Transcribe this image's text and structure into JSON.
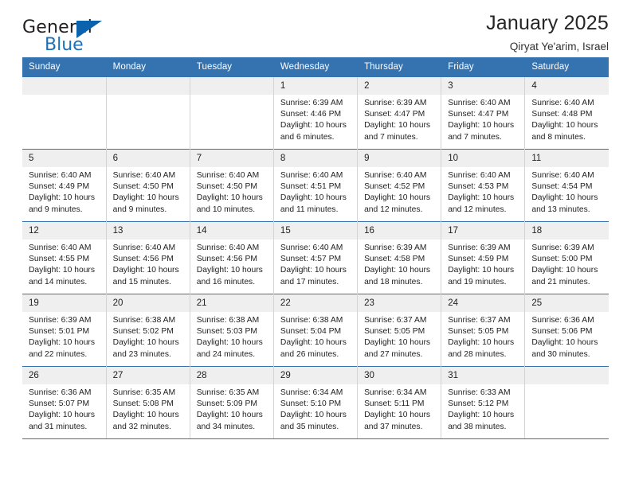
{
  "brand": {
    "name_part1": "General",
    "name_part2": "Blue",
    "triangle_icon": "blue-triangle-logo"
  },
  "header": {
    "title": "January 2025",
    "subtitle": "Qiryat Ye'arim, Israel"
  },
  "colors": {
    "header_blue": "#3572b0",
    "brand_blue": "#1d71b8",
    "daynum_band": "#efefef",
    "grid_line": "#d4d4d4"
  },
  "weekday_headers": [
    "Sunday",
    "Monday",
    "Tuesday",
    "Wednesday",
    "Thursday",
    "Friday",
    "Saturday"
  ],
  "labels": {
    "sunrise_prefix": "Sunrise:",
    "sunset_prefix": "Sunset:",
    "daylight_prefix": "Daylight:"
  },
  "weeks": [
    [
      {
        "empty": true
      },
      {
        "empty": true
      },
      {
        "empty": true
      },
      {
        "day": "1",
        "sunrise": "Sunrise: 6:39 AM",
        "sunset": "Sunset: 4:46 PM",
        "daylight1": "Daylight: 10 hours",
        "daylight2": "and 6 minutes."
      },
      {
        "day": "2",
        "sunrise": "Sunrise: 6:39 AM",
        "sunset": "Sunset: 4:47 PM",
        "daylight1": "Daylight: 10 hours",
        "daylight2": "and 7 minutes."
      },
      {
        "day": "3",
        "sunrise": "Sunrise: 6:40 AM",
        "sunset": "Sunset: 4:47 PM",
        "daylight1": "Daylight: 10 hours",
        "daylight2": "and 7 minutes."
      },
      {
        "day": "4",
        "sunrise": "Sunrise: 6:40 AM",
        "sunset": "Sunset: 4:48 PM",
        "daylight1": "Daylight: 10 hours",
        "daylight2": "and 8 minutes."
      }
    ],
    [
      {
        "day": "5",
        "sunrise": "Sunrise: 6:40 AM",
        "sunset": "Sunset: 4:49 PM",
        "daylight1": "Daylight: 10 hours",
        "daylight2": "and 9 minutes."
      },
      {
        "day": "6",
        "sunrise": "Sunrise: 6:40 AM",
        "sunset": "Sunset: 4:50 PM",
        "daylight1": "Daylight: 10 hours",
        "daylight2": "and 9 minutes."
      },
      {
        "day": "7",
        "sunrise": "Sunrise: 6:40 AM",
        "sunset": "Sunset: 4:50 PM",
        "daylight1": "Daylight: 10 hours",
        "daylight2": "and 10 minutes."
      },
      {
        "day": "8",
        "sunrise": "Sunrise: 6:40 AM",
        "sunset": "Sunset: 4:51 PM",
        "daylight1": "Daylight: 10 hours",
        "daylight2": "and 11 minutes."
      },
      {
        "day": "9",
        "sunrise": "Sunrise: 6:40 AM",
        "sunset": "Sunset: 4:52 PM",
        "daylight1": "Daylight: 10 hours",
        "daylight2": "and 12 minutes."
      },
      {
        "day": "10",
        "sunrise": "Sunrise: 6:40 AM",
        "sunset": "Sunset: 4:53 PM",
        "daylight1": "Daylight: 10 hours",
        "daylight2": "and 12 minutes."
      },
      {
        "day": "11",
        "sunrise": "Sunrise: 6:40 AM",
        "sunset": "Sunset: 4:54 PM",
        "daylight1": "Daylight: 10 hours",
        "daylight2": "and 13 minutes."
      }
    ],
    [
      {
        "day": "12",
        "sunrise": "Sunrise: 6:40 AM",
        "sunset": "Sunset: 4:55 PM",
        "daylight1": "Daylight: 10 hours",
        "daylight2": "and 14 minutes."
      },
      {
        "day": "13",
        "sunrise": "Sunrise: 6:40 AM",
        "sunset": "Sunset: 4:56 PM",
        "daylight1": "Daylight: 10 hours",
        "daylight2": "and 15 minutes."
      },
      {
        "day": "14",
        "sunrise": "Sunrise: 6:40 AM",
        "sunset": "Sunset: 4:56 PM",
        "daylight1": "Daylight: 10 hours",
        "daylight2": "and 16 minutes."
      },
      {
        "day": "15",
        "sunrise": "Sunrise: 6:40 AM",
        "sunset": "Sunset: 4:57 PM",
        "daylight1": "Daylight: 10 hours",
        "daylight2": "and 17 minutes."
      },
      {
        "day": "16",
        "sunrise": "Sunrise: 6:39 AM",
        "sunset": "Sunset: 4:58 PM",
        "daylight1": "Daylight: 10 hours",
        "daylight2": "and 18 minutes."
      },
      {
        "day": "17",
        "sunrise": "Sunrise: 6:39 AM",
        "sunset": "Sunset: 4:59 PM",
        "daylight1": "Daylight: 10 hours",
        "daylight2": "and 19 minutes."
      },
      {
        "day": "18",
        "sunrise": "Sunrise: 6:39 AM",
        "sunset": "Sunset: 5:00 PM",
        "daylight1": "Daylight: 10 hours",
        "daylight2": "and 21 minutes."
      }
    ],
    [
      {
        "day": "19",
        "sunrise": "Sunrise: 6:39 AM",
        "sunset": "Sunset: 5:01 PM",
        "daylight1": "Daylight: 10 hours",
        "daylight2": "and 22 minutes."
      },
      {
        "day": "20",
        "sunrise": "Sunrise: 6:38 AM",
        "sunset": "Sunset: 5:02 PM",
        "daylight1": "Daylight: 10 hours",
        "daylight2": "and 23 minutes."
      },
      {
        "day": "21",
        "sunrise": "Sunrise: 6:38 AM",
        "sunset": "Sunset: 5:03 PM",
        "daylight1": "Daylight: 10 hours",
        "daylight2": "and 24 minutes."
      },
      {
        "day": "22",
        "sunrise": "Sunrise: 6:38 AM",
        "sunset": "Sunset: 5:04 PM",
        "daylight1": "Daylight: 10 hours",
        "daylight2": "and 26 minutes."
      },
      {
        "day": "23",
        "sunrise": "Sunrise: 6:37 AM",
        "sunset": "Sunset: 5:05 PM",
        "daylight1": "Daylight: 10 hours",
        "daylight2": "and 27 minutes."
      },
      {
        "day": "24",
        "sunrise": "Sunrise: 6:37 AM",
        "sunset": "Sunset: 5:05 PM",
        "daylight1": "Daylight: 10 hours",
        "daylight2": "and 28 minutes."
      },
      {
        "day": "25",
        "sunrise": "Sunrise: 6:36 AM",
        "sunset": "Sunset: 5:06 PM",
        "daylight1": "Daylight: 10 hours",
        "daylight2": "and 30 minutes."
      }
    ],
    [
      {
        "day": "26",
        "sunrise": "Sunrise: 6:36 AM",
        "sunset": "Sunset: 5:07 PM",
        "daylight1": "Daylight: 10 hours",
        "daylight2": "and 31 minutes."
      },
      {
        "day": "27",
        "sunrise": "Sunrise: 6:35 AM",
        "sunset": "Sunset: 5:08 PM",
        "daylight1": "Daylight: 10 hours",
        "daylight2": "and 32 minutes."
      },
      {
        "day": "28",
        "sunrise": "Sunrise: 6:35 AM",
        "sunset": "Sunset: 5:09 PM",
        "daylight1": "Daylight: 10 hours",
        "daylight2": "and 34 minutes."
      },
      {
        "day": "29",
        "sunrise": "Sunrise: 6:34 AM",
        "sunset": "Sunset: 5:10 PM",
        "daylight1": "Daylight: 10 hours",
        "daylight2": "and 35 minutes."
      },
      {
        "day": "30",
        "sunrise": "Sunrise: 6:34 AM",
        "sunset": "Sunset: 5:11 PM",
        "daylight1": "Daylight: 10 hours",
        "daylight2": "and 37 minutes."
      },
      {
        "day": "31",
        "sunrise": "Sunrise: 6:33 AM",
        "sunset": "Sunset: 5:12 PM",
        "daylight1": "Daylight: 10 hours",
        "daylight2": "and 38 minutes."
      },
      {
        "empty": true
      }
    ]
  ]
}
